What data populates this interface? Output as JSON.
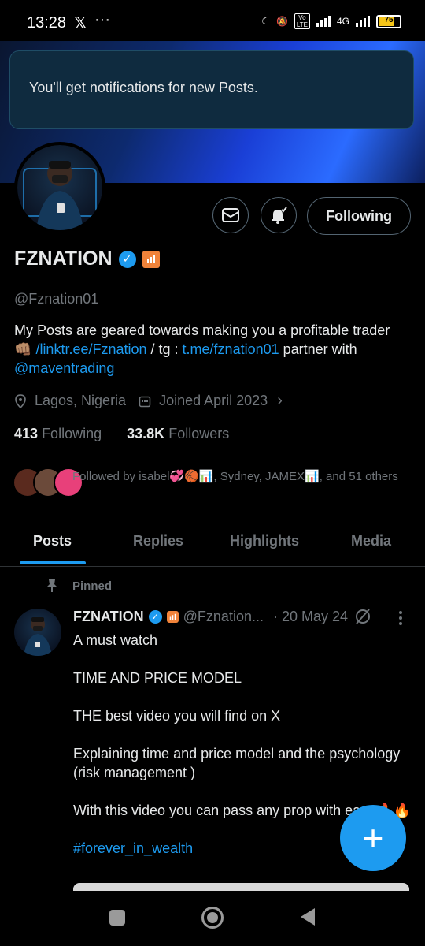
{
  "status_bar": {
    "time": "13:28",
    "battery": "75",
    "network": "4G"
  },
  "toast": {
    "message": "You'll get notifications for new Posts."
  },
  "profile": {
    "name": "FZNATION",
    "handle": "@Fznation01",
    "bio": {
      "line1": "My Posts are geared towards making you a profitable trader",
      "emoji": "👊🏽",
      "link1": "/linktr.ee/Fznation",
      "sep": " / tg : ",
      "link2": "t.me/fznation01",
      "after": "  partner with",
      "mention": "@maventrading"
    },
    "location": "Lagos, Nigeria",
    "joined": "Joined April 2023",
    "following_count": "413",
    "following_label": "Following",
    "followers_count": "33.8K",
    "followers_label": "Followers",
    "followed_by": "Followed by isabel💞🏀📊, Sydney, JAMEX📊, and 51 others"
  },
  "actions": {
    "follow_label": "Following"
  },
  "tabs": [
    "Posts",
    "Replies",
    "Highlights",
    "Media"
  ],
  "post": {
    "pinned_label": "Pinned",
    "author": "FZNATION",
    "handle": "@Fznation...",
    "date": "· 20 May 24",
    "lines": [
      "A must watch",
      "TIME AND PRICE MODEL",
      "THE best video you will find on X",
      "Explaining time and price model and the psychology (risk management )",
      "With this video you can pass any prop with ease🔥🔥"
    ],
    "hashtag": "#forever_in_wealth"
  },
  "colors": {
    "accent": "#1d9bf0",
    "muted": "#71767b",
    "text": "#e7e9ea"
  }
}
